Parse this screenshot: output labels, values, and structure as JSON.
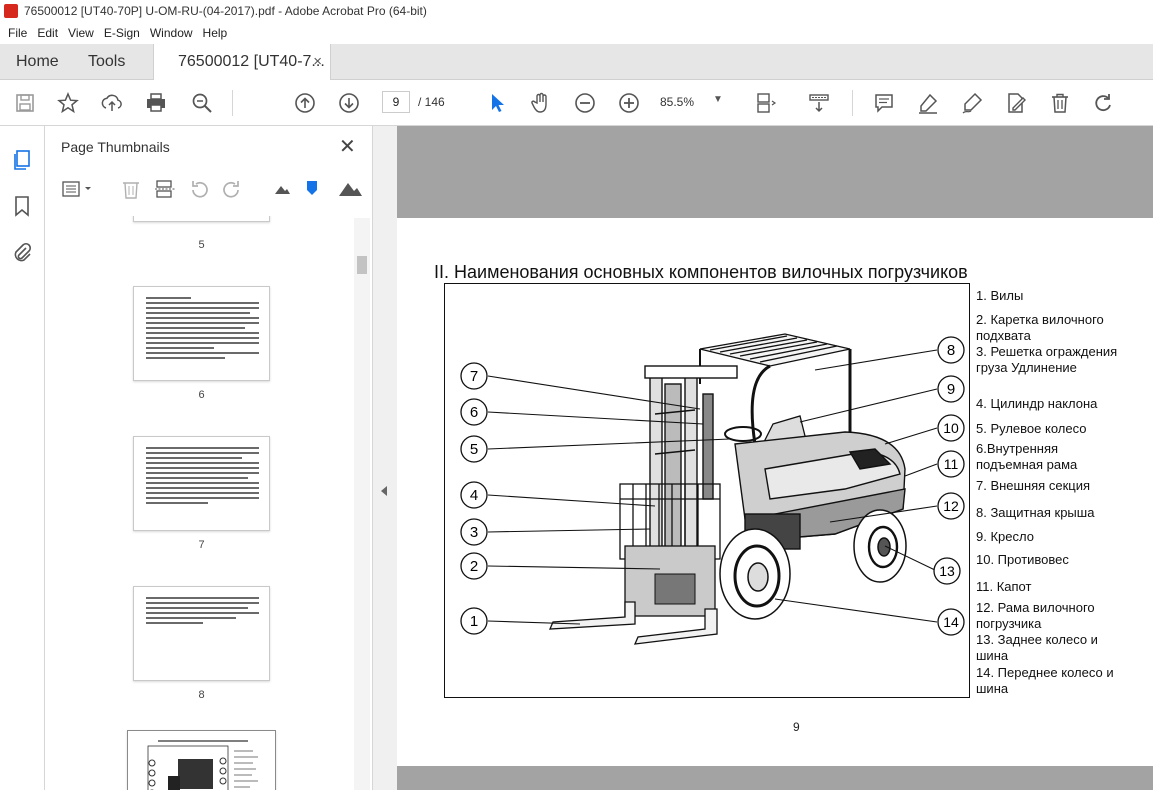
{
  "window": {
    "title": "76500012 [UT40-70P] U-OM-RU-(04-2017).pdf - Adobe Acrobat Pro (64-bit)"
  },
  "menu": [
    "File",
    "Edit",
    "View",
    "E-Sign",
    "Window",
    "Help"
  ],
  "tabs": {
    "home": "Home",
    "tools": "Tools",
    "document": "76500012 [UT40-7...",
    "close_glyph": "×"
  },
  "toolbar": {
    "current_page": "9",
    "total_pages": "/ 146",
    "zoom": "85.5%",
    "icons": [
      "save-icon",
      "bookmark-star-icon",
      "upload-icon",
      "print-icon",
      "find-icon",
      "prev-page-icon",
      "next-page-icon",
      "select-cursor-icon",
      "hand-icon",
      "zoom-out-icon",
      "zoom-in-icon",
      "page-fit-icon",
      "scroll-mode-icon",
      "comment-icon",
      "highlight-icon",
      "sign-icon",
      "edit-pdf-icon",
      "delete-icon",
      "rotate-icon"
    ]
  },
  "thumbnails_panel": {
    "title": "Page Thumbnails",
    "close_glyph": "✕",
    "pages": [
      {
        "label": "5"
      },
      {
        "label": "6"
      },
      {
        "label": "7"
      },
      {
        "label": "8"
      }
    ]
  },
  "document": {
    "heading": "II. Наименования основных компонентов вилочных погрузчиков",
    "callouts": [
      "1",
      "2",
      "3",
      "4",
      "5",
      "6",
      "7",
      "8",
      "9",
      "10",
      "11",
      "12",
      "13",
      "14"
    ],
    "legend": [
      "1. Вилы",
      "2.  Каретка  вилочного подхвата",
      "3. Решетка ограждения груза Удлинение",
      "4. Цилиндр наклона",
      "5. Рулевое колесо",
      "6.Внутренняя подъемная рама",
      "7. Внешняя секция",
      "8. Защитная крыша",
      "9. Кресло",
      "10. Противовес",
      "11. Капот",
      "12.  Рама  вилочного погрузчика",
      "13.  Заднее  колесо  и шина",
      "14.  Переднее  колесо и шина"
    ],
    "page_number": "9"
  }
}
